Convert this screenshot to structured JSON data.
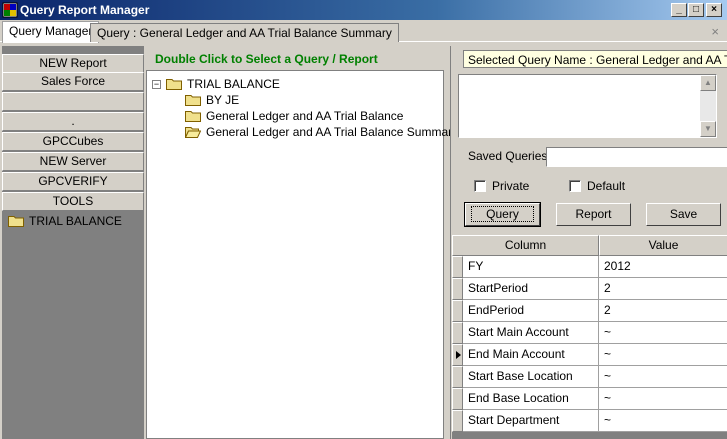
{
  "window": {
    "title": "Query Report Manager"
  },
  "tabs": [
    {
      "label": "Query Manager"
    },
    {
      "label": "Query : General Ledger and AA Trial Balance Summary"
    }
  ],
  "tab_close": "×",
  "left_nav": {
    "buttons": [
      "NEW Report",
      "Sales Force",
      "",
      ".",
      "GPCCubes",
      "NEW Server",
      "GPCVERIFY",
      "TOOLS"
    ],
    "selected_item": "TRIAL BALANCE"
  },
  "tree": {
    "hint": "Double Click to Select a Query / Report",
    "root": "TRIAL BALANCE",
    "expander": "−",
    "children": [
      "BY JE",
      "General Ledger and AA Trial Balance",
      "General Ledger and AA Trial Balance Summary"
    ]
  },
  "right_panel": {
    "selected_query": "Selected Query Name :  General Ledger and AA Trial Balance Summary",
    "saved_queries_label": "Saved Queries",
    "saved_queries_value": "",
    "private_label": "Private",
    "default_label": "Default",
    "buttons": {
      "query": "Query",
      "report": "Report",
      "save": "Save"
    }
  },
  "grid": {
    "columns": [
      "Column",
      "Value"
    ],
    "rows": [
      {
        "column": "FY",
        "value": "2012"
      },
      {
        "column": "StartPeriod",
        "value": "2"
      },
      {
        "column": "EndPeriod",
        "value": "2"
      },
      {
        "column": "Start Main Account",
        "value": "~"
      },
      {
        "column": "End Main Account",
        "value": "~"
      },
      {
        "column": "Start Base Location",
        "value": "~"
      },
      {
        "column": "End Base Location",
        "value": "~"
      },
      {
        "column": "Start Department",
        "value": "~"
      }
    ],
    "current_row_index": 4
  }
}
